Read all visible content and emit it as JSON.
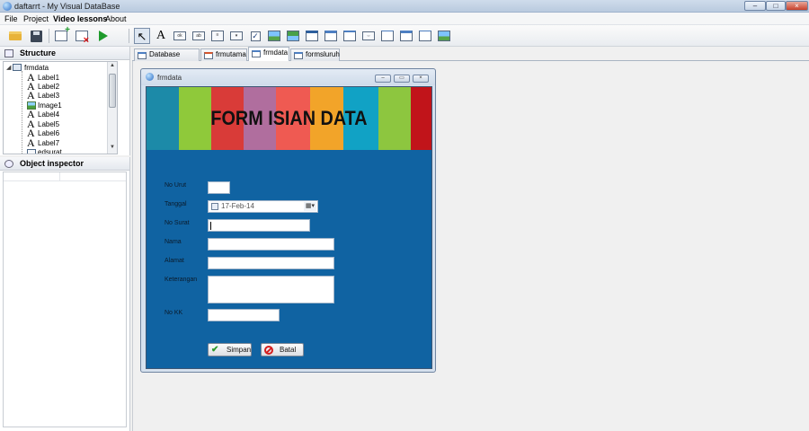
{
  "app": {
    "title": "daftarrt - My Visual DataBase",
    "window_controls": {
      "minimize": "–",
      "maximize": "□",
      "close": "×"
    }
  },
  "menu": [
    "File",
    "Project",
    "Video lessons",
    "About"
  ],
  "toolbar": {
    "icons": [
      "open-folder-icon",
      "save-disk-icon",
      "new-form-icon",
      "delete-form-icon",
      "run-play-icon",
      "pointer-icon",
      "label-A-icon",
      "button-component-icon",
      "edit-component-icon",
      "memo-component-icon",
      "combobox-component-icon",
      "checkbox-icon",
      "image-icon",
      "grid-icon",
      "db-grid-icon",
      "panel-icon",
      "tab-icon",
      "window-icon",
      "form-icon",
      "picture-icon"
    ]
  },
  "structure": {
    "header": "Structure",
    "tree": [
      {
        "label": "frmdata",
        "type": "form"
      },
      {
        "label": "Label1",
        "type": "label"
      },
      {
        "label": "Label2",
        "type": "label"
      },
      {
        "label": "Label3",
        "type": "label"
      },
      {
        "label": "Image1",
        "type": "image"
      },
      {
        "label": "Label4",
        "type": "label"
      },
      {
        "label": "Label5",
        "type": "label"
      },
      {
        "label": "Label6",
        "type": "label"
      },
      {
        "label": "Label7",
        "type": "label"
      },
      {
        "label": "edsurat",
        "type": "edit"
      }
    ]
  },
  "inspector": {
    "header": "Object inspector"
  },
  "tabs": [
    {
      "label": "Database tables",
      "active": false
    },
    {
      "label": "frmutama",
      "active": false
    },
    {
      "label": "frmdata",
      "active": true
    },
    {
      "label": "formsluruh",
      "active": false
    }
  ],
  "form": {
    "window_title": "frmdata",
    "banner_title": "FORM ISIAN DATA",
    "banner_colors": [
      "#1c8aa8",
      "#8fc93a",
      "#d93b38",
      "#b06e9e",
      "#ef5a52",
      "#f2a429",
      "#11a2c5",
      "#8dc63f",
      "#c1141a"
    ],
    "background_color": "#1063a2",
    "fields": {
      "no_urut": {
        "label": "No Urut",
        "value": ""
      },
      "tanggal": {
        "label": "Tanggal",
        "value": "17-Feb-14"
      },
      "no_surat": {
        "label": "No Surat",
        "value": ""
      },
      "nama": {
        "label": "Nama",
        "value": ""
      },
      "alamat": {
        "label": "Alamat",
        "value": ""
      },
      "keterangan": {
        "label": "Keterangan",
        "value": ""
      },
      "no_kk": {
        "label": "No KK",
        "value": ""
      }
    },
    "buttons": {
      "save": "Simpan",
      "cancel": "Batal"
    }
  }
}
